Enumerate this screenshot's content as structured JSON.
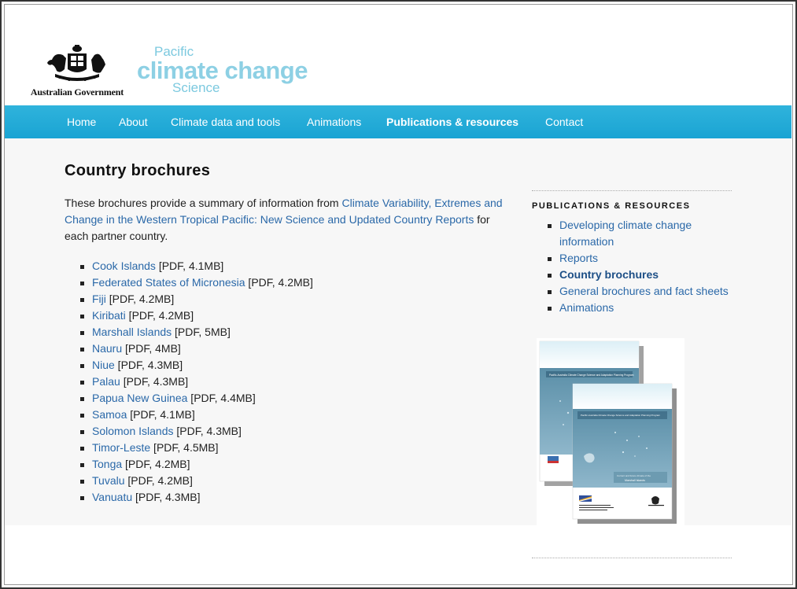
{
  "header": {
    "gov_name": "Australian Government",
    "brand": {
      "line1": "Pacific",
      "line2": "climate change",
      "line3": "Science"
    }
  },
  "nav": {
    "items": [
      {
        "label": "Home"
      },
      {
        "label": "About"
      },
      {
        "label": "Climate data and tools"
      },
      {
        "label": "Animations"
      },
      {
        "label": "Publications & resources",
        "active": true
      },
      {
        "label": "Contact"
      }
    ]
  },
  "main": {
    "title": "Country brochures",
    "intro": {
      "before": "These brochures provide a summary of information from ",
      "link": "Climate Variability, Extremes and Change in the Western Tropical Pacific: New Science and Updated Country Reports",
      "after": " for each partner country."
    },
    "brochures": [
      {
        "name": "Cook Islands",
        "meta": " [PDF, 4.1MB]"
      },
      {
        "name": "Federated States of Micronesia",
        "meta": " [PDF, 4.2MB]"
      },
      {
        "name": "Fiji",
        "meta": " [PDF, 4.2MB]"
      },
      {
        "name": "Kiribati",
        "meta": " [PDF, 4.2MB]"
      },
      {
        "name": "Marshall Islands",
        "meta": " [PDF, 5MB]"
      },
      {
        "name": "Nauru",
        "meta": " [PDF, 4MB]"
      },
      {
        "name": "Niue",
        "meta": " [PDF, 4.3MB]"
      },
      {
        "name": "Palau",
        "meta": " [PDF, 4.3MB]"
      },
      {
        "name": "Papua New Guinea",
        "meta": " [PDF, 4.4MB]"
      },
      {
        "name": "Samoa",
        "meta": " [PDF, 4.1MB]"
      },
      {
        "name": "Solomon Islands",
        "meta": " [PDF, 4.3MB]"
      },
      {
        "name": "Timor-Leste",
        "meta": " [PDF, 4.5MB]"
      },
      {
        "name": "Tonga",
        "meta": " [PDF, 4.2MB]"
      },
      {
        "name": "Tuvalu",
        "meta": " [PDF, 4.2MB]"
      },
      {
        "name": "Vanuatu",
        "meta": " [PDF, 4.3MB]"
      }
    ]
  },
  "sidebar": {
    "heading": "PUBLICATIONS & RESOURCES",
    "items": [
      {
        "label": "Developing climate change information"
      },
      {
        "label": "Reports"
      },
      {
        "label": "Country brochures",
        "current": true
      },
      {
        "label": "General brochures and fact sheets"
      },
      {
        "label": "Animations"
      }
    ],
    "cover": {
      "back_title": "Pacific-Australia Climate Change Science and Adaptation Planning Program",
      "front_title": "Pacific-Australia Climate Change Science and Adaptation Planning Program",
      "front_caption": "Marshall Islands",
      "front_sub": "Current and future climate of the"
    }
  },
  "colors": {
    "nav_bg": "#1fa9d8",
    "link": "#2a68a8",
    "brand": "#8dd0e4",
    "content_bg": "#f7f7f7"
  }
}
